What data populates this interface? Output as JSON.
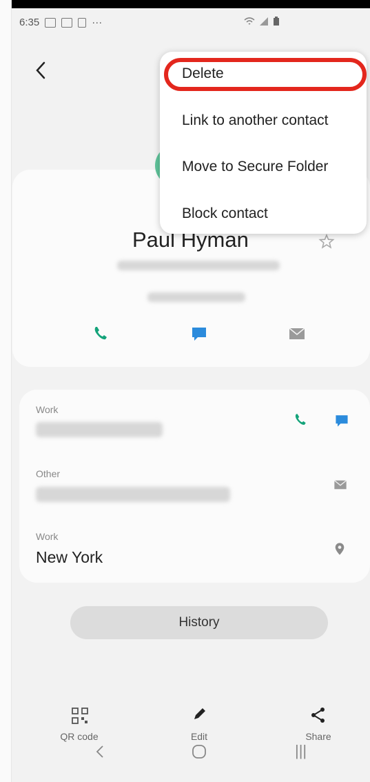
{
  "status_bar": {
    "time": "6:35",
    "more": "···"
  },
  "contact": {
    "name": "Paul Hyman"
  },
  "menu": {
    "items": [
      {
        "label": "Delete"
      },
      {
        "label": "Link to another contact"
      },
      {
        "label": "Move to Secure Folder"
      },
      {
        "label": "Block contact"
      }
    ]
  },
  "details": [
    {
      "label": "Work"
    },
    {
      "label": "Other"
    },
    {
      "label": "Work",
      "value": "New York"
    }
  ],
  "history_label": "History",
  "bottom_bar": {
    "qr": "QR code",
    "edit": "Edit",
    "share": "Share"
  },
  "nav": {
    "recents": "|||"
  },
  "colors": {
    "accent_green": "#14a37a",
    "accent_blue": "#2b8bdc",
    "highlight_red": "#e3271d"
  }
}
